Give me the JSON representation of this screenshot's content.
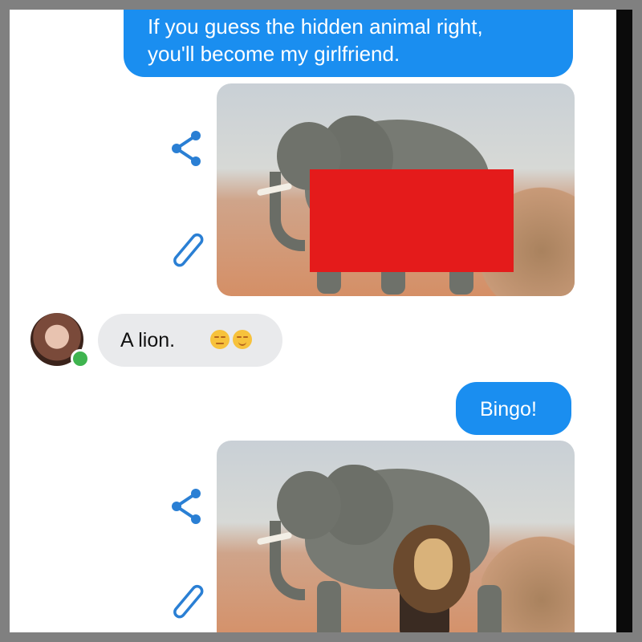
{
  "chat": {
    "message_1": {
      "line_1": "If you guess the hidden animal right,",
      "line_2": "you'll become my girlfriend."
    },
    "reply": {
      "text": "A lion.",
      "emojis": [
        "unamused-face",
        "relieved-face"
      ]
    },
    "message_2": {
      "text": "Bingo!"
    }
  },
  "colors": {
    "outgoing_bubble": "#1a8ef0",
    "incoming_bubble": "#e9eaec",
    "icon_blue": "#2a7fd4",
    "online_dot": "#3fb44f",
    "censor_red": "#e41b1b"
  },
  "icons": {
    "share": "share-icon",
    "edit": "pencil-icon"
  }
}
